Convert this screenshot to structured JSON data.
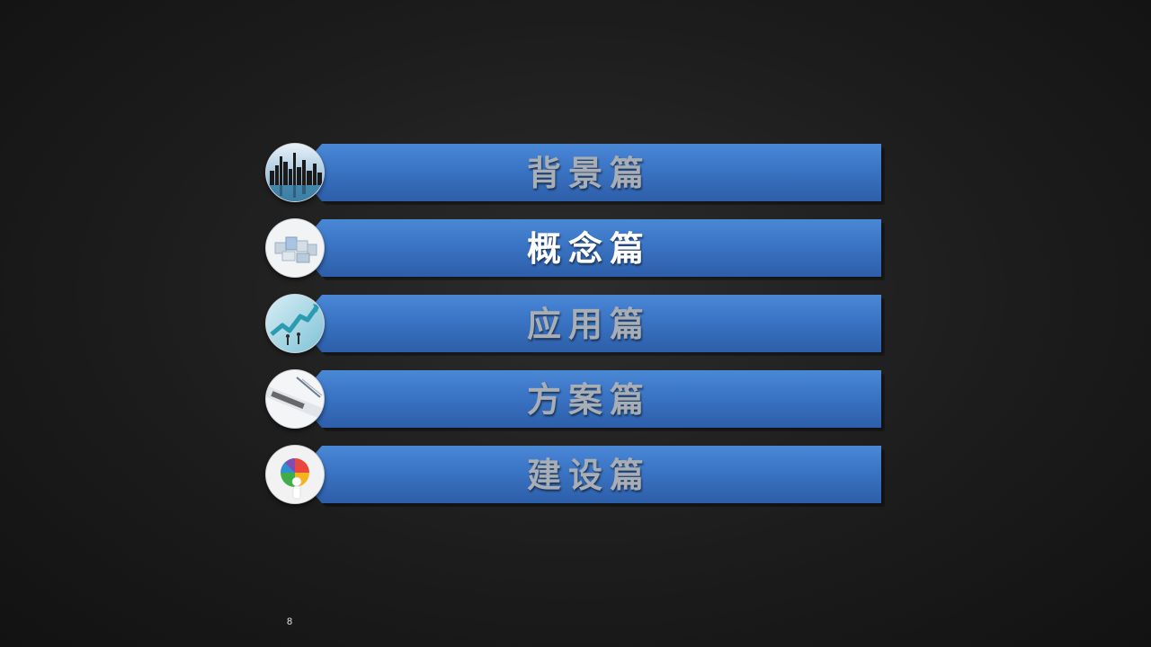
{
  "agenda": {
    "items": [
      {
        "label": "背景篇",
        "icon": "city-skyline-icon",
        "active": false
      },
      {
        "label": "概念篇",
        "icon": "building-blocks-icon",
        "active": true
      },
      {
        "label": "应用篇",
        "icon": "growth-arrow-icon",
        "active": false
      },
      {
        "label": "方案篇",
        "icon": "solution-document-icon",
        "active": false
      },
      {
        "label": "建设篇",
        "icon": "puzzle-figure-icon",
        "active": false
      }
    ]
  },
  "footer": {
    "page_number": "8"
  },
  "colors": {
    "bar_top": "#4a88d6",
    "bar_bottom": "#2d5ea9",
    "label_inactive": "#a8aeb6",
    "label_active": "#ffffff",
    "background": "#1c1c1c"
  }
}
